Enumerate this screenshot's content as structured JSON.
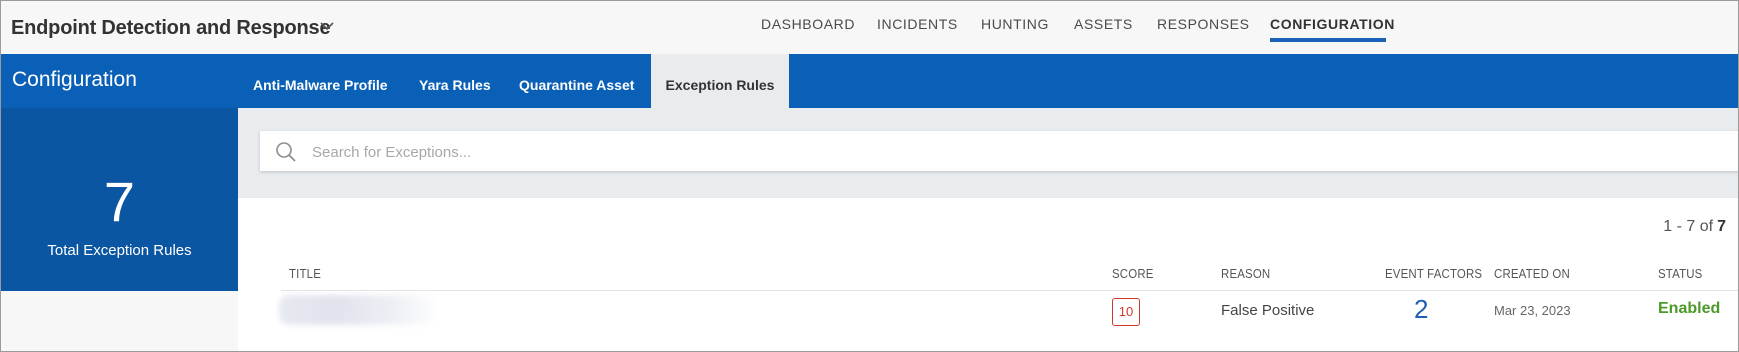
{
  "header": {
    "app_title": "Endpoint Detection and Response",
    "nav": [
      "DASHBOARD",
      "INCIDENTS",
      "HUNTING",
      "ASSETS",
      "RESPONSES",
      "CONFIGURATION"
    ],
    "active_nav": "CONFIGURATION"
  },
  "page": {
    "title": "Configuration",
    "tabs": [
      "Anti-Malware Profile",
      "Yara Rules",
      "Quarantine Asset",
      "Exception Rules"
    ],
    "active_tab": "Exception Rules"
  },
  "summary": {
    "count": "7",
    "label": "Total Exception Rules"
  },
  "search": {
    "placeholder": "Search for Exceptions..."
  },
  "pagination": {
    "range": "1 - 7 of",
    "total": "7"
  },
  "table": {
    "columns": [
      "TITLE",
      "SCORE",
      "REASON",
      "EVENT FACTORS",
      "CREATED ON",
      "STATUS"
    ],
    "rows": [
      {
        "title": "",
        "score": "10",
        "reason": "False Positive",
        "event_factors": "2",
        "created_on": "Mar 23, 2023",
        "status": "Enabled"
      }
    ]
  },
  "colors": {
    "brand_blue": "#0a60b6",
    "stat_blue": "#0b56a3",
    "score_red": "#d03a2e",
    "status_green": "#4c9a2a"
  }
}
